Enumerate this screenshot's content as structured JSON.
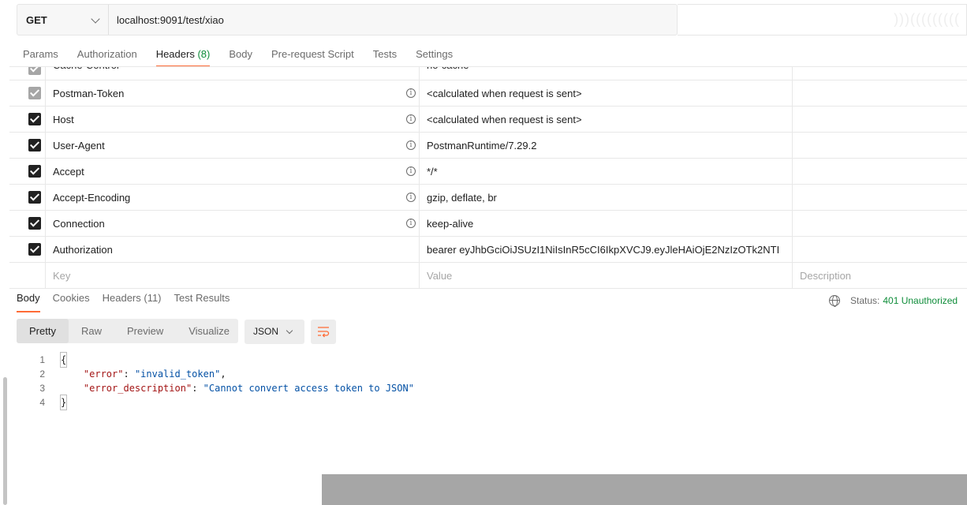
{
  "request": {
    "method": "GET",
    "url": "localhost:9091/test/xiao"
  },
  "request_tabs": [
    {
      "label": "Params"
    },
    {
      "label": "Authorization"
    },
    {
      "label": "Headers",
      "count": "(8)"
    },
    {
      "label": "Body"
    },
    {
      "label": "Pre-request Script"
    },
    {
      "label": "Tests"
    },
    {
      "label": "Settings"
    }
  ],
  "headers": {
    "rows": [
      {
        "key": "Cache-Control",
        "value": "no-cache"
      },
      {
        "key": "Postman-Token",
        "value": "<calculated when request is sent>"
      },
      {
        "key": "Host",
        "value": "<calculated when request is sent>"
      },
      {
        "key": "User-Agent",
        "value": "PostmanRuntime/7.29.2"
      },
      {
        "key": "Accept",
        "value": "*/*"
      },
      {
        "key": "Accept-Encoding",
        "value": "gzip, deflate, br"
      },
      {
        "key": "Connection",
        "value": "keep-alive"
      },
      {
        "key": "Authorization",
        "value": "bearer eyJhbGciOiJSUzI1NiIsInR5cCI6IkpXVCJ9.eyJleHAiOjE2NzIzOTk2NTI"
      }
    ],
    "placeholder": {
      "key": "Key",
      "value": "Value",
      "description": "Description"
    }
  },
  "response_tabs": [
    {
      "label": "Body"
    },
    {
      "label": "Cookies"
    },
    {
      "label": "Headers (11)"
    },
    {
      "label": "Test Results"
    }
  ],
  "status": {
    "label": "Status:",
    "code": "401 Unauthorized"
  },
  "views": [
    "Pretty",
    "Raw",
    "Preview",
    "Visualize"
  ],
  "format": "JSON",
  "body_lines": {
    "l1": "1",
    "l2": "2",
    "l3": "3",
    "l4": "4",
    "open": "{",
    "k1": "\"error\"",
    "v1": "\"invalid_token\"",
    "k2": "\"error_description\"",
    "v2": "\"Cannot convert access token to JSON\"",
    "close": "}"
  }
}
